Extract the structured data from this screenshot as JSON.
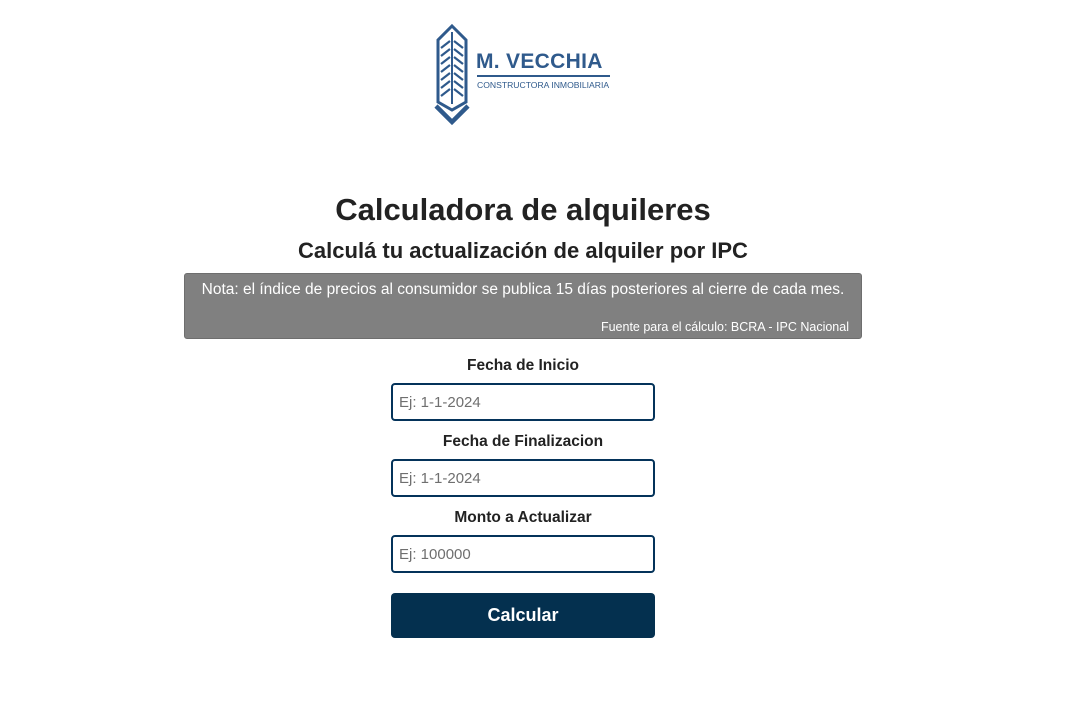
{
  "logo": {
    "name": "M. VECCHIA",
    "tagline": "CONSTRUCTORA INMOBILIARIA",
    "icon": "building-icon",
    "color": "#2f5a8c"
  },
  "header": {
    "title": "Calculadora de alquileres",
    "subtitle": "Calculá tu actualización de alquiler por IPC"
  },
  "note": {
    "text": "Nota: el índice de precios al consumidor se publica 15 días posteriores al cierre de cada mes.",
    "source": "Fuente para el cálculo: BCRA - IPC Nacional",
    "background": "#808080"
  },
  "form": {
    "start_date": {
      "label": "Fecha de Inicio",
      "placeholder": "Ej: 1-1-2024",
      "value": ""
    },
    "end_date": {
      "label": "Fecha de Finalizacion",
      "placeholder": "Ej: 1-1-2024",
      "value": ""
    },
    "amount": {
      "label": "Monto a Actualizar",
      "placeholder": "Ej: 100000",
      "value": ""
    },
    "submit_label": "Calcular",
    "accent": "#04304f"
  }
}
